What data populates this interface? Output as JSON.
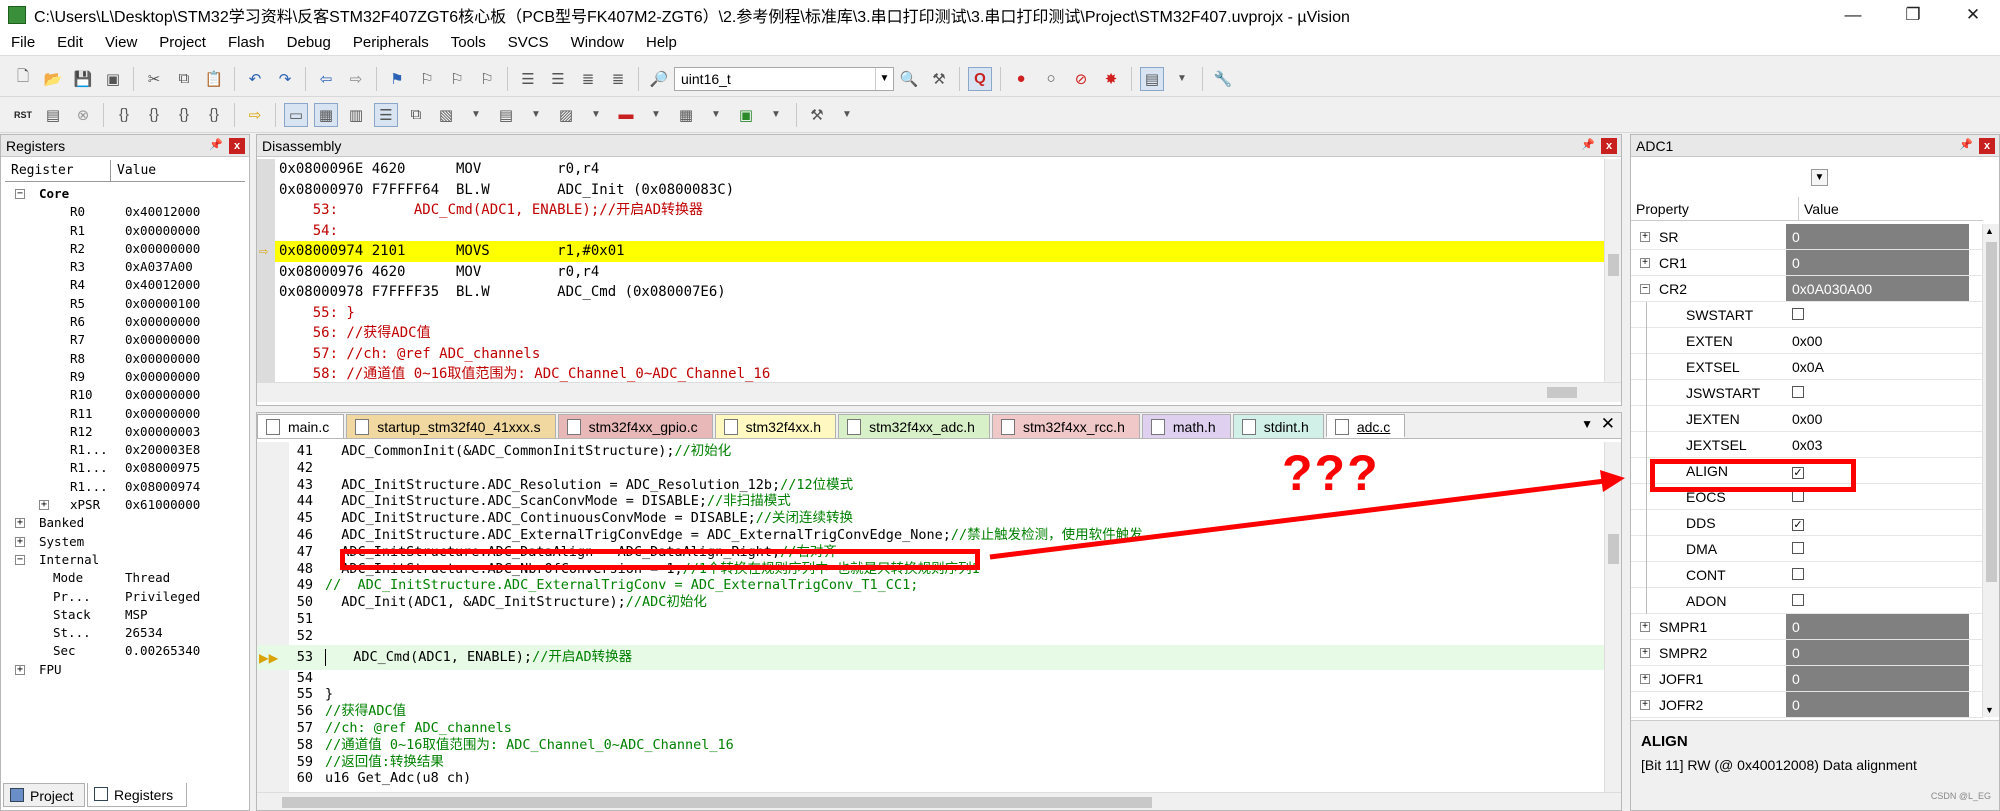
{
  "window": {
    "title": "C:\\Users\\L\\Desktop\\STM32学习资料\\反客STM32F407ZGT6核心板（PCB型号FK407M2-ZGT6）\\2.参考例程\\标准库\\3.串口打印测试\\3.串口打印测试\\Project\\STM32F407.uvprojx - µVision",
    "minimize": "—",
    "maximize": "❐",
    "close": "✕"
  },
  "menu": [
    "File",
    "Edit",
    "View",
    "Project",
    "Flash",
    "Debug",
    "Peripherals",
    "Tools",
    "SVCS",
    "Window",
    "Help"
  ],
  "toolbar": {
    "type_combo": "uint16_t",
    "rst_label": "RST"
  },
  "registers": {
    "title": "Registers",
    "col_register": "Register",
    "col_value": "Value",
    "core_label": "Core",
    "rows": [
      {
        "name": "R0",
        "value": "0x40012000"
      },
      {
        "name": "R1",
        "value": "0x00000000"
      },
      {
        "name": "R2",
        "value": "0x00000000"
      },
      {
        "name": "R3",
        "value": "0xA037A00"
      },
      {
        "name": "R4",
        "value": "0x40012000"
      },
      {
        "name": "R5",
        "value": "0x00000100"
      },
      {
        "name": "R6",
        "value": "0x00000000"
      },
      {
        "name": "R7",
        "value": "0x00000000"
      },
      {
        "name": "R8",
        "value": "0x00000000"
      },
      {
        "name": "R9",
        "value": "0x00000000"
      },
      {
        "name": "R10",
        "value": "0x00000000"
      },
      {
        "name": "R11",
        "value": "0x00000000"
      },
      {
        "name": "R12",
        "value": "0x00000003"
      },
      {
        "name": "R1...",
        "value": "0x200003E8"
      },
      {
        "name": "R1...",
        "value": "0x08000975"
      },
      {
        "name": "R1...",
        "value": "0x08000974"
      },
      {
        "name": "xPSR",
        "value": "0x61000000"
      }
    ],
    "banked": "Banked",
    "system": "System",
    "internal": "Internal",
    "internal_rows": [
      {
        "name": "Mode",
        "value": "Thread"
      },
      {
        "name": "Pr...",
        "value": "Privileged"
      },
      {
        "name": "Stack",
        "value": "MSP"
      },
      {
        "name": "St...",
        "value": "26534"
      },
      {
        "name": "Sec",
        "value": "0.00265340"
      }
    ],
    "fpu": "FPU",
    "bottom_tabs": [
      "Project",
      "Registers"
    ]
  },
  "disassembly": {
    "title": "Disassembly",
    "lines": [
      "0x0800096E 4620      MOV         r0,r4",
      "0x08000970 F7FFFF64  BL.W        ADC_Init (0x0800083C)",
      "    53:         ADC_Cmd(ADC1, ENABLE);//开启AD转换器",
      "    54:",
      "0x08000974 2101      MOVS        r1,#0x01",
      "0x08000976 4620      MOV         r0,r4",
      "0x08000978 F7FFFF35  BL.W        ADC_Cmd (0x080007E6)",
      "    55: }",
      "    56: //获得ADC值",
      "    57: //ch: @ref ADC_channels",
      "    58: //通道值 0~16取值范围为: ADC_Channel_0~ADC_Channel_16"
    ]
  },
  "editor": {
    "tabs": [
      "main.c",
      "startup_stm32f40_41xxx.s",
      "stm32f4xx_gpio.c",
      "stm32f4xx.h",
      "stm32f4xx_adc.h",
      "stm32f4xx_rcc.h",
      "math.h",
      "stdint.h",
      "adc.c"
    ],
    "lines": [
      {
        "n": "41",
        "code": "  ADC_CommonInit(&ADC_CommonInitStructure);",
        "cm": "//初始化"
      },
      {
        "n": "42",
        "code": "",
        "cm": ""
      },
      {
        "n": "43",
        "code": "  ADC_InitStructure.ADC_Resolution = ADC_Resolution_12b;",
        "cm": "//12位模式"
      },
      {
        "n": "44",
        "code": "  ADC_InitStructure.ADC_ScanConvMode = DISABLE;",
        "cm": "//非扫描模式"
      },
      {
        "n": "45",
        "code": "  ADC_InitStructure.ADC_ContinuousConvMode = DISABLE;",
        "cm": "//关闭连续转换"
      },
      {
        "n": "46",
        "code": "  ADC_InitStructure.ADC_ExternalTrigConvEdge = ADC_ExternalTrigConvEdge_None;",
        "cm": "//禁止触发检测，使用软件触发"
      },
      {
        "n": "47",
        "code": "  ADC_InitStructure.ADC_DataAlign = ADC_DataAlign_Right;",
        "cm": "//右对齐"
      },
      {
        "n": "48",
        "code": "  ADC_InitStructure.ADC_NbrOfConversion = 1;",
        "cm": "//1个转换在规则序列中 也就是只转换规则序列1"
      },
      {
        "n": "49",
        "code": "",
        "cm": "//  ADC_InitStructure.ADC_ExternalTrigConv = ADC_ExternalTrigConv_T1_CC1;"
      },
      {
        "n": "50",
        "code": "  ADC_Init(ADC1, &ADC_InitStructure);",
        "cm": "//ADC初始化"
      },
      {
        "n": "51",
        "code": "",
        "cm": ""
      },
      {
        "n": "52",
        "code": "",
        "cm": ""
      },
      {
        "n": "53",
        "code": "  ADC_Cmd(ADC1, ENABLE);",
        "cm": "//开启AD转换器"
      },
      {
        "n": "54",
        "code": "",
        "cm": ""
      },
      {
        "n": "55",
        "code": "}",
        "cm": ""
      },
      {
        "n": "56",
        "code": "",
        "cm": "//获得ADC值"
      },
      {
        "n": "57",
        "code": "",
        "cm": "//ch: @ref ADC_channels"
      },
      {
        "n": "58",
        "code": "",
        "cm": "//通道值 0~16取值范围为: ADC_Channel_0~ADC_Channel_16"
      },
      {
        "n": "59",
        "code": "",
        "cm": "//返回值:转换结果"
      },
      {
        "n": "60",
        "code": "u16 Get_Adc(u8 ch)",
        "cm": ""
      }
    ]
  },
  "annotation": {
    "text": "???"
  },
  "adc1": {
    "title": "ADC1",
    "col_property": "Property",
    "col_value": "Value",
    "rows": [
      {
        "name": "SR",
        "value": "0",
        "kind": "group"
      },
      {
        "name": "CR1",
        "value": "0",
        "kind": "group"
      },
      {
        "name": "CR2",
        "value": "0x0A030A00",
        "kind": "group-open"
      },
      {
        "name": "SWSTART",
        "value": "",
        "kind": "chk",
        "checked": false
      },
      {
        "name": "EXTEN",
        "value": "0x00",
        "kind": "field"
      },
      {
        "name": "EXTSEL",
        "value": "0x0A",
        "kind": "field"
      },
      {
        "name": "JSWSTART",
        "value": "",
        "kind": "chk",
        "checked": false
      },
      {
        "name": "JEXTEN",
        "value": "0x00",
        "kind": "field"
      },
      {
        "name": "JEXTSEL",
        "value": "0x03",
        "kind": "field"
      },
      {
        "name": "ALIGN",
        "value": "",
        "kind": "chk",
        "checked": true
      },
      {
        "name": "EOCS",
        "value": "",
        "kind": "chk",
        "checked": false
      },
      {
        "name": "DDS",
        "value": "",
        "kind": "chk",
        "checked": true
      },
      {
        "name": "DMA",
        "value": "",
        "kind": "chk",
        "checked": false
      },
      {
        "name": "CONT",
        "value": "",
        "kind": "chk",
        "checked": false
      },
      {
        "name": "ADON",
        "value": "",
        "kind": "chk",
        "checked": false
      },
      {
        "name": "SMPR1",
        "value": "0",
        "kind": "group"
      },
      {
        "name": "SMPR2",
        "value": "0",
        "kind": "group"
      },
      {
        "name": "JOFR1",
        "value": "0",
        "kind": "group"
      },
      {
        "name": "JOFR2",
        "value": "0",
        "kind": "group"
      }
    ],
    "desc_title": "ALIGN",
    "desc_text": "[Bit 11] RW (@ 0x40012008) Data alignment",
    "watermark": "CSDN @L_EG"
  },
  "colors": {
    "highlight": "#ffff00",
    "accent_red": "#ff0000",
    "code_comment": "#008000"
  }
}
